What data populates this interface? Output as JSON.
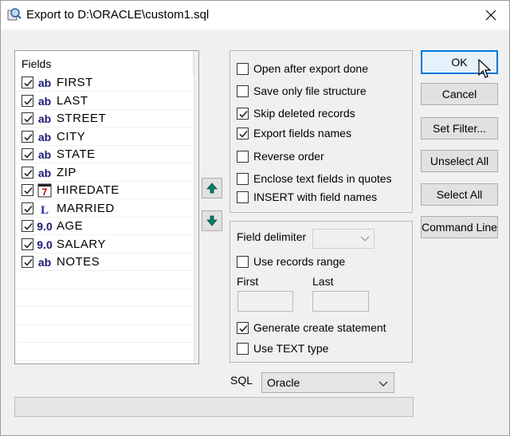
{
  "window": {
    "title": "Export to D:\\ORACLE\\custom1.sql"
  },
  "fields": {
    "header": "Fields",
    "items": [
      {
        "type_label": "ab",
        "type_icon": "text-type-icon",
        "name": "FIRST",
        "checked": true
      },
      {
        "type_label": "ab",
        "type_icon": "text-type-icon",
        "name": "LAST",
        "checked": true
      },
      {
        "type_label": "ab",
        "type_icon": "text-type-icon",
        "name": "STREET",
        "checked": true
      },
      {
        "type_label": "ab",
        "type_icon": "text-type-icon",
        "name": "CITY",
        "checked": true
      },
      {
        "type_label": "ab",
        "type_icon": "text-type-icon",
        "name": "STATE",
        "checked": true
      },
      {
        "type_label": "ab",
        "type_icon": "text-type-icon",
        "name": "ZIP",
        "checked": true
      },
      {
        "type_label": "",
        "type_icon": "date-type-icon",
        "name": "HIREDATE",
        "checked": true
      },
      {
        "type_label": "",
        "type_icon": "logical-type-icon",
        "name": "MARRIED",
        "checked": true
      },
      {
        "type_label": "9.0",
        "type_icon": "numeric-type-icon",
        "name": "AGE",
        "checked": true
      },
      {
        "type_label": "9.0",
        "type_icon": "numeric-type-icon",
        "name": "SALARY",
        "checked": true
      },
      {
        "type_label": "ab",
        "type_icon": "text-type-icon",
        "name": "NOTES",
        "checked": true
      }
    ]
  },
  "options": [
    {
      "label": "Open after export done",
      "checked": false
    },
    {
      "label": "Save only file structure",
      "checked": false
    },
    {
      "label": "Skip deleted records",
      "checked": true
    },
    {
      "label": "Export fields names",
      "checked": true
    },
    {
      "label": "Reverse order",
      "checked": false
    },
    {
      "label": "Enclose text fields in quotes",
      "checked": false
    },
    {
      "label": "INSERT with field names",
      "checked": false
    }
  ],
  "delimiter": {
    "label": "Field delimiter",
    "value": "",
    "use_range": {
      "label": "Use records range",
      "checked": false
    },
    "first_label": "First",
    "first_value": "",
    "last_label": "Last",
    "last_value": "",
    "generate_create": {
      "label": "Generate create statement",
      "checked": true
    },
    "use_text_type": {
      "label": "Use TEXT type",
      "checked": false
    }
  },
  "sql": {
    "label": "SQL",
    "value": "Oracle"
  },
  "buttons": {
    "ok": "OK",
    "cancel": "Cancel",
    "set_filter": "Set Filter...",
    "unselect_all": "Unselect All",
    "select_all": "Select All",
    "command_line": "Command Line"
  },
  "colors": {
    "accent": "#0078d7",
    "arrow_green": "#008060",
    "date_red": "#c00000"
  }
}
